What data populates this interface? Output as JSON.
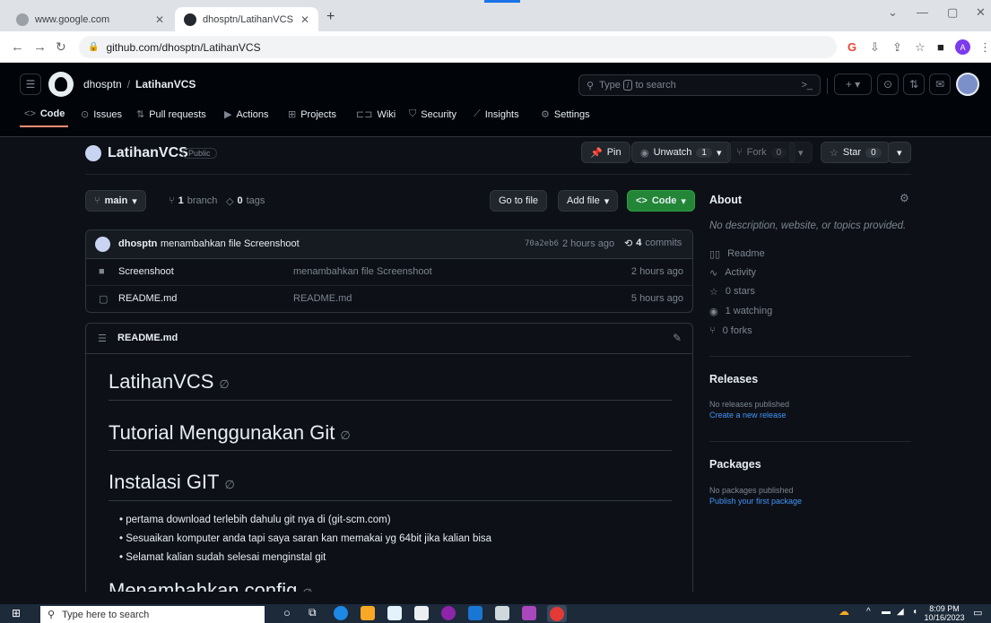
{
  "browser": {
    "tabs": [
      {
        "title": "www.google.com",
        "active": false
      },
      {
        "title": "dhosptn/LatihanVCS",
        "active": true
      }
    ],
    "new_tab": "+",
    "url": "github.com/dhosptn/LatihanVCS",
    "window_controls": {
      "minimize": "—",
      "restore": "▢",
      "close": "✕",
      "dropdown": "⌄"
    },
    "profile_initial": "A"
  },
  "github": {
    "breadcrumb_owner": "dhosptn",
    "breadcrumb_sep": "/",
    "breadcrumb_repo": "LatihanVCS",
    "search_prefix": "Type",
    "search_key": "/",
    "search_suffix": "to search",
    "nav": [
      {
        "label": "Code",
        "icon": "<>"
      },
      {
        "label": "Issues",
        "icon": "⊙"
      },
      {
        "label": "Pull requests",
        "icon": "⇅"
      },
      {
        "label": "Actions",
        "icon": "▶"
      },
      {
        "label": "Projects",
        "icon": "⊞"
      },
      {
        "label": "Wiki",
        "icon": "⊏⊐"
      },
      {
        "label": "Security",
        "icon": "⛉"
      },
      {
        "label": "Insights",
        "icon": "⟋"
      },
      {
        "label": "Settings",
        "icon": "⚙"
      }
    ]
  },
  "repo": {
    "name": "LatihanVCS",
    "visibility": "Public",
    "pin": "Pin",
    "unwatch": "Unwatch",
    "unwatch_count": "1",
    "fork": "Fork",
    "fork_count": "0",
    "star": "Star",
    "star_count": "0",
    "branch": "main",
    "branches_count": "1",
    "branches_label": "branch",
    "tags_count": "0",
    "tags_label": "tags",
    "go_to_file": "Go to file",
    "add_file": "Add file",
    "code_btn": "Code"
  },
  "latest_commit": {
    "author": "dhosptn",
    "message": "menambahkan file Screenshoot",
    "hash": "70a2eb6",
    "time": "2 hours ago",
    "commits_count": "4",
    "commits_label": "commits"
  },
  "files": [
    {
      "name": "Screenshoot",
      "type": "folder",
      "message": "menambahkan file Screenshoot",
      "time": "2 hours ago"
    },
    {
      "name": "README.md",
      "type": "file",
      "message": "README.md",
      "time": "5 hours ago"
    }
  ],
  "readme": {
    "filename": "README.md",
    "headings": [
      "LatihanVCS",
      "Tutorial Menggunakan Git",
      "Instalasi GIT",
      "Menambahkan config"
    ],
    "list": [
      "pertama download terlebih dahulu git nya di (git-scm.com)",
      "Sesuaikan komputer anda tapi saya saran kan memakai yg 64bit jika kalian bisa",
      "Selamat kalian sudah selesai menginstal git"
    ]
  },
  "about": {
    "title": "About",
    "description": "No description, website, or topics provided.",
    "items": [
      {
        "icon": "📖",
        "label": "Readme"
      },
      {
        "icon": "∿",
        "label": "Activity"
      },
      {
        "icon": "☆",
        "label": "0 stars"
      },
      {
        "icon": "◉",
        "label": "1 watching"
      },
      {
        "icon": "⑂",
        "label": "0 forks"
      }
    ]
  },
  "releases": {
    "title": "Releases",
    "none": "No releases published",
    "link": "Create a new release"
  },
  "packages": {
    "title": "Packages",
    "none": "No packages published",
    "link": "Publish your first package"
  },
  "taskbar": {
    "search_placeholder": "Type here to search",
    "time": "8:09 PM",
    "date": "10/16/2023"
  },
  "colors": {
    "accent_green": "#238636",
    "link_blue": "#4493f8",
    "bg": "#0d1117"
  }
}
